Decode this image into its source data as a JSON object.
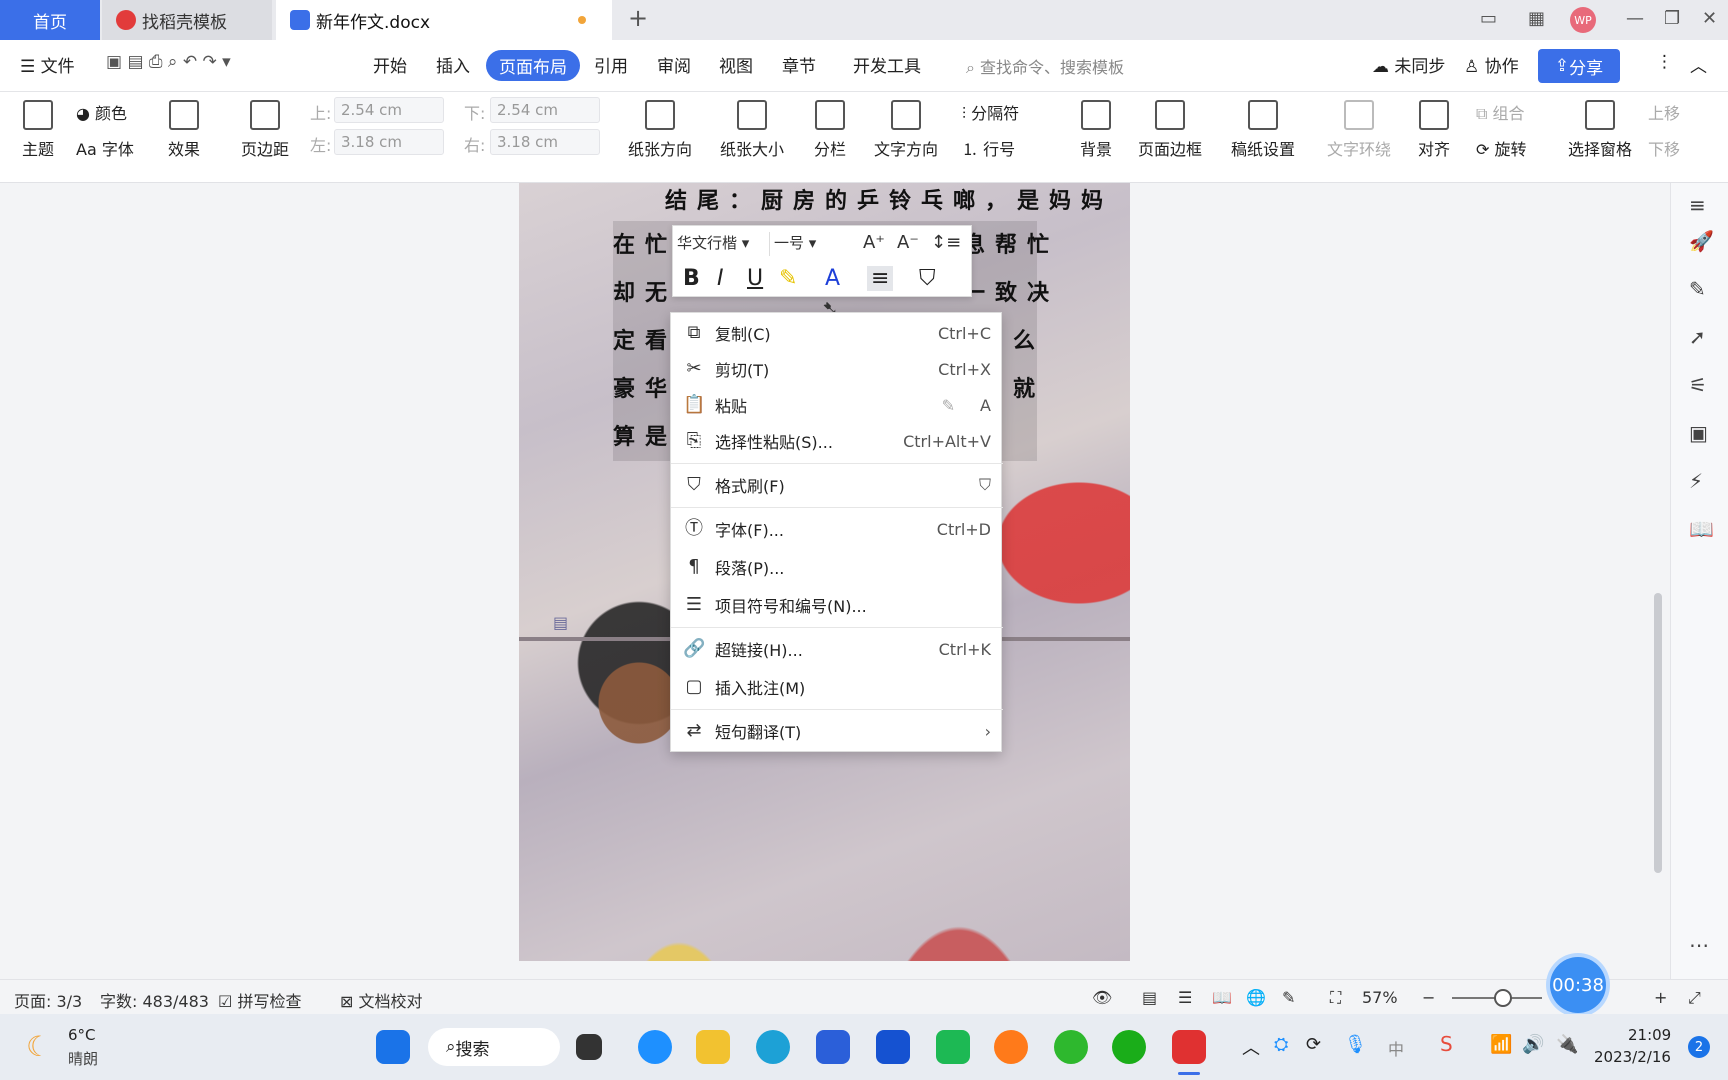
{
  "titlebar": {
    "tabs": [
      {
        "label": "首页"
      },
      {
        "label": "找稻壳模板"
      },
      {
        "label": "新年作文.docx"
      }
    ],
    "new_tab": "+",
    "avatar": "WP"
  },
  "menubar": {
    "file": "文件",
    "items": [
      "开始",
      "插入",
      "页面布局",
      "引用",
      "审阅",
      "视图",
      "章节",
      "开发工具"
    ],
    "search_placeholder": "查找命令、搜索模板",
    "unsynced": "未同步",
    "collab": "协作",
    "share": "分享"
  },
  "ribbon": {
    "theme": "主题",
    "color": "颜色",
    "font": "Aa 字体",
    "effect": "效果",
    "margin": "页边距",
    "top_label": "上:",
    "top_value": "2.54 cm",
    "bottom_label": "下:",
    "bottom_value": "2.54 cm",
    "left_label": "左:",
    "left_value": "3.18 cm",
    "right_label": "右:",
    "right_value": "3.18 cm",
    "orientation": "纸张方向",
    "size": "纸张大小",
    "columns": "分栏",
    "text_direction": "文字方向",
    "separator": "分隔符",
    "line_number": "行号",
    "background": "背景",
    "page_border": "页面边框",
    "manuscript": "稿纸设置",
    "text_wrap": "文字环绕",
    "align": "对齐",
    "group": "组合",
    "rotate": "旋转",
    "selection_pane": "选择窗格",
    "move_up": "上移",
    "move_down": "下移"
  },
  "document": {
    "lines": [
      "结尾：厨房的乒铃乓啷，是妈妈",
      "在忙",
      "息帮忙",
      "却无",
      "一致决",
      "定看",
      "么",
      "豪华",
      "就",
      "算是"
    ]
  },
  "minitoolbar": {
    "font_name": "华文行楷",
    "font_size": "一号"
  },
  "context_menu": {
    "items": [
      {
        "label": "复制(C)",
        "shortcut": "Ctrl+C"
      },
      {
        "label": "剪切(T)",
        "shortcut": "Ctrl+X"
      },
      {
        "label": "粘贴",
        "shortcut": ""
      },
      {
        "label": "选择性粘贴(S)...",
        "shortcut": "Ctrl+Alt+V"
      },
      {
        "label": "格式刷(F)",
        "shortcut": ""
      },
      {
        "label": "字体(F)...",
        "shortcut": "Ctrl+D"
      },
      {
        "label": "段落(P)...",
        "shortcut": ""
      },
      {
        "label": "项目符号和编号(N)...",
        "shortcut": ""
      },
      {
        "label": "超链接(H)...",
        "shortcut": "Ctrl+K"
      },
      {
        "label": "插入批注(M)",
        "shortcut": ""
      },
      {
        "label": "短句翻译(T)",
        "shortcut": "›"
      }
    ]
  },
  "statusbar": {
    "page": "页面: 3/3",
    "words": "字数: 483/483",
    "spellcheck": "拼写检查",
    "proofread": "文档校对",
    "zoom": "57%",
    "timer": "00:38"
  },
  "taskbar": {
    "temp": "6°C",
    "weather": "晴朗",
    "search": "搜索",
    "time": "21:09",
    "date": "2023/2/16",
    "ime": "中",
    "notif_count": "2"
  }
}
